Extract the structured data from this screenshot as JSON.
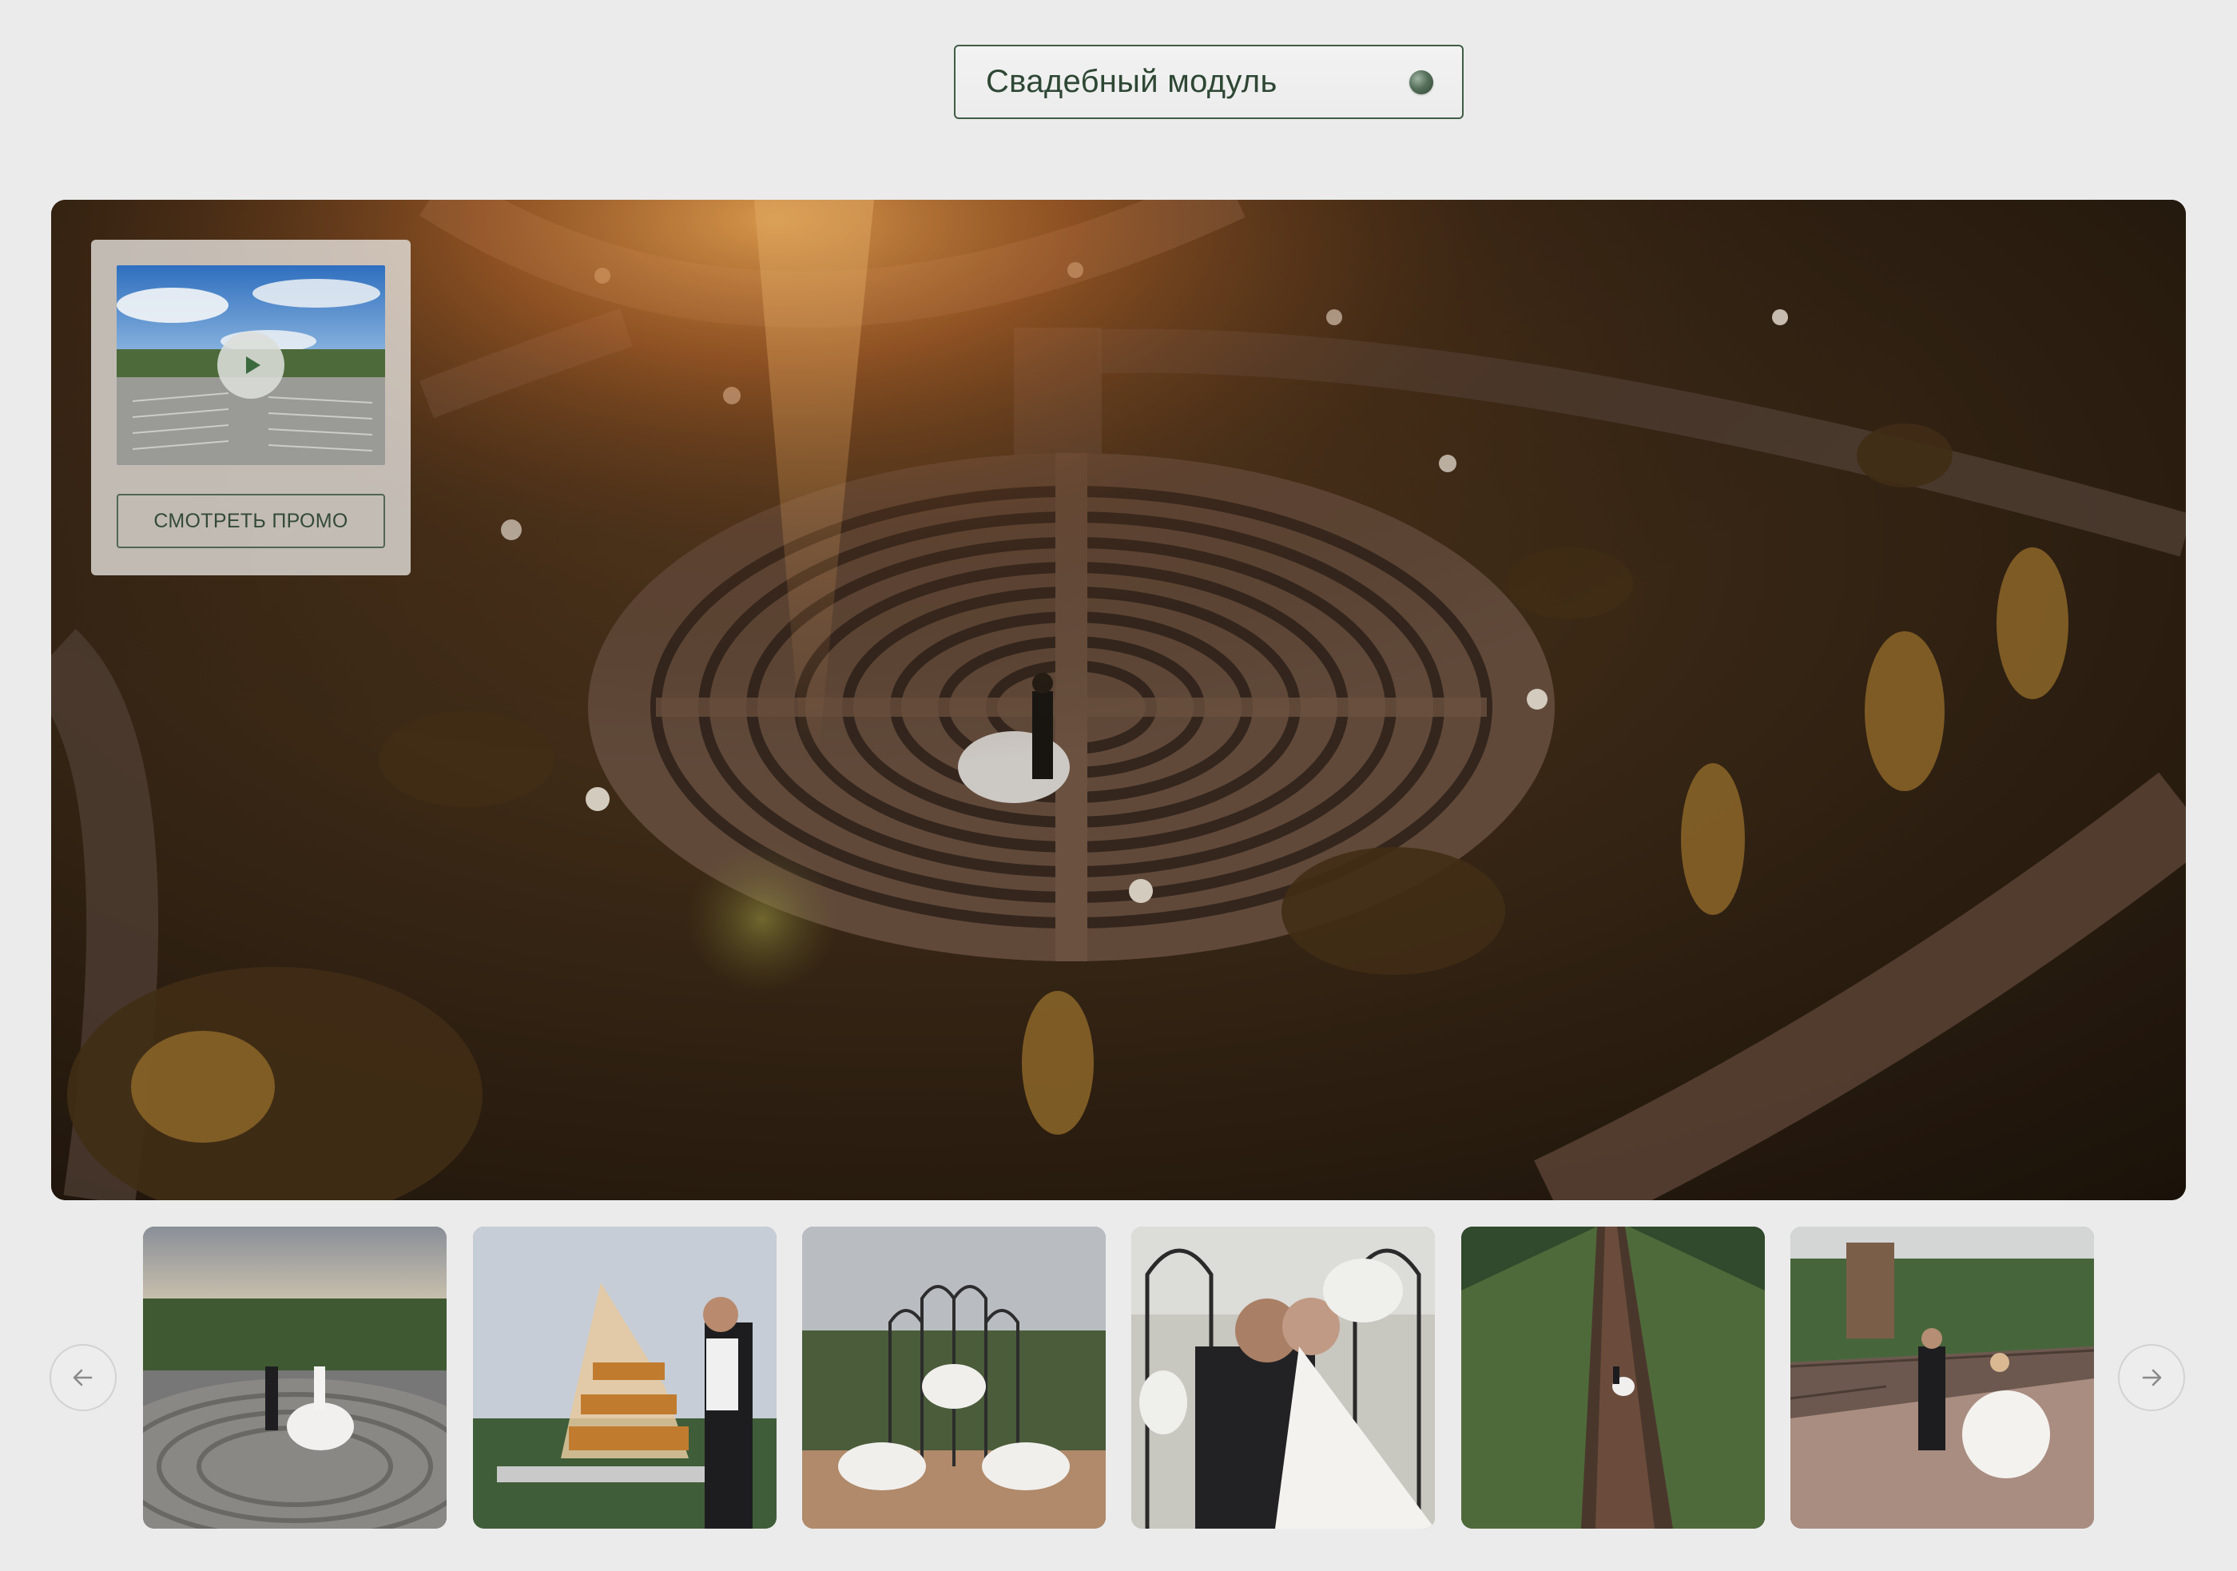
{
  "module_selector": {
    "label": "Свадебный модуль"
  },
  "hero": {
    "image": "aerial-wedding-labyrinth-photo"
  },
  "promo": {
    "button_label": "СМОТРЕТЬ ПРОМО",
    "thumbnail_image": "outdoor-ceremony-chairs-photo",
    "play_icon": "play-icon"
  },
  "gallery": {
    "prev_icon": "arrow-left-icon",
    "next_icon": "arrow-right-icon",
    "thumbnails": [
      {
        "image": "couple-on-labyrinth-photo"
      },
      {
        "image": "champagne-tower-photo"
      },
      {
        "image": "arch-floral-decor-photo"
      },
      {
        "image": "couple-embrace-photo"
      },
      {
        "image": "couple-on-boardwalk-aerial-photo"
      },
      {
        "image": "couple-walking-bridge-photo"
      }
    ]
  },
  "colors": {
    "accent": "#3f5c45",
    "background": "#ebebeb",
    "text": "#2e4734"
  }
}
